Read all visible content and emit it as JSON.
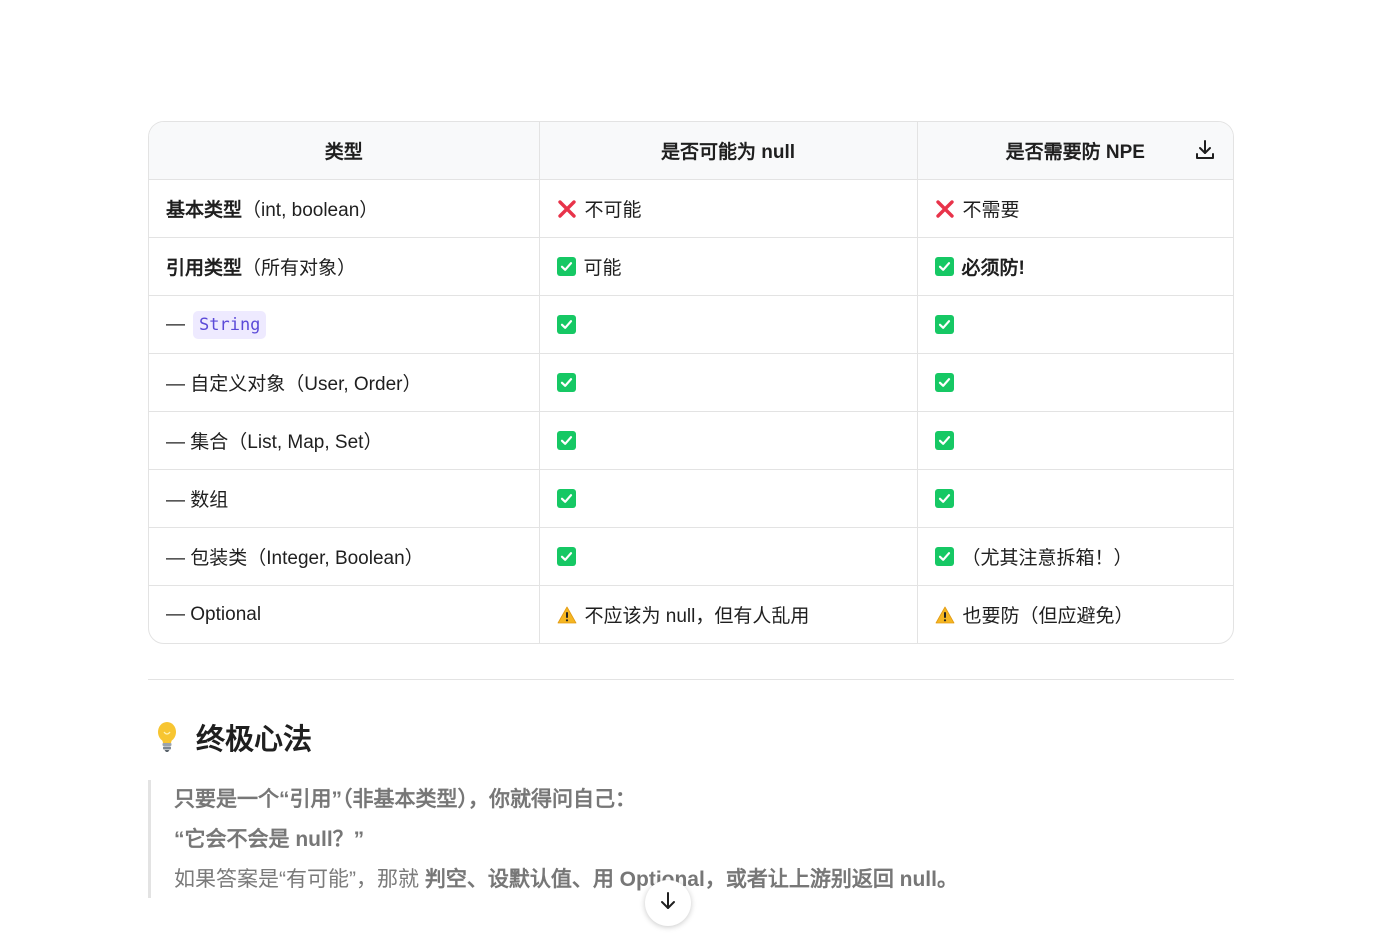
{
  "table": {
    "headers": [
      "类型",
      "是否可能为 null",
      "是否需要防 NPE"
    ],
    "rows": [
      {
        "type_bold": "基本类型",
        "type_rest": "（int, boolean）",
        "c2_icon": "cross-icon",
        "c2_text": "不可能",
        "c3_icon": "cross-icon",
        "c3_text": "不需要"
      },
      {
        "type_bold": "引用类型",
        "type_rest": "（所有对象）",
        "c2_icon": "check-icon",
        "c2_text": "可能",
        "c3_icon": "check-icon",
        "c3_text": "必须防!"
      },
      {
        "type_prefix": "—",
        "type_code": "String",
        "c2_icon": "check-icon",
        "c3_icon": "check-icon"
      },
      {
        "type_text": "— 自定义对象（User, Order）",
        "c2_icon": "check-icon",
        "c3_icon": "check-icon"
      },
      {
        "type_text": "— 集合（List, Map, Set）",
        "c2_icon": "check-icon",
        "c3_icon": "check-icon"
      },
      {
        "type_text": "— 数组",
        "c2_icon": "check-icon",
        "c3_icon": "check-icon"
      },
      {
        "type_text": "— 包装类（Integer, Boolean）",
        "c2_icon": "check-icon",
        "c3_icon": "check-icon",
        "c3_text": "（尤其注意拆箱！）"
      },
      {
        "type_text": "— Optional",
        "c2_icon": "warning-icon",
        "c2_text": "不应该为 null，但有人乱用",
        "c3_icon": "warning-icon",
        "c3_text": "也要防（但应避免）"
      }
    ]
  },
  "section": {
    "icon": "lightbulb-icon",
    "title": "终极心法"
  },
  "quote": {
    "line1": "只要是一个“引用”（非基本类型），你就得问自己：",
    "line2": "“它会不会是 null？”",
    "line3_prefix": "如果答案是“有可能”，那就 ",
    "line3_bold": "判空、设默认值、用 Optional，或者让上游别返回 null。"
  },
  "colors": {
    "check": "#16c864",
    "cross": "#e8334a",
    "code_text": "#5b4ad8",
    "code_bg": "#eeeaff"
  }
}
